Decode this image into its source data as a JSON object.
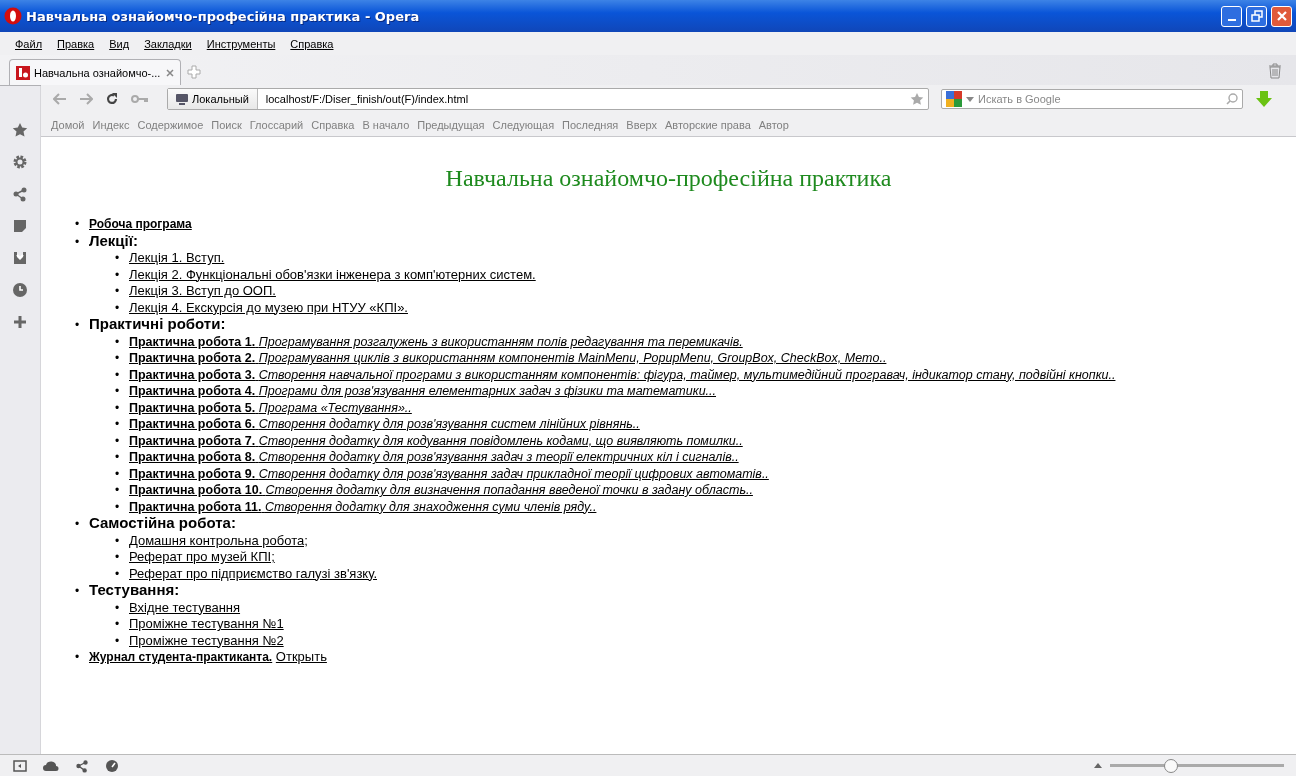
{
  "window": {
    "title": "Навчальна ознайомчо-професійна практика - Opera"
  },
  "menu": [
    "Файл",
    "Правка",
    "Вид",
    "Закладки",
    "Инструменты",
    "Справка"
  ],
  "tabs": [
    {
      "label": "Навчальна ознайомчо-...",
      "selected": true
    }
  ],
  "address_bar": {
    "badge": "Локальный",
    "value": "localhost/F:/Diser_finish/out(F)/index.html"
  },
  "search": {
    "placeholder": "Искать в Google"
  },
  "nav_links": [
    "Домой",
    "Индекс",
    "Содержимое",
    "Поиск",
    "Глоссарий",
    "Справка",
    "В начало",
    "Предыдущая",
    "Следующая",
    "Последняя",
    "Вверх",
    "Авторские права",
    "Автор"
  ],
  "page": {
    "heading": "Навчальна ознайомчо-професійна практика",
    "items": [
      {
        "kind": "link",
        "bullet": "•",
        "text": "Робоча програма"
      },
      {
        "kind": "section",
        "bullet": "•",
        "text": "Лекції:",
        "children": [
          {
            "kind": "plain",
            "bullet": "•",
            "text": "Лекція 1. Вступ."
          },
          {
            "kind": "plain",
            "bullet": "•",
            "text": "Лекція 2. Функціональні обов'язки інженера з комп'ютерних систем."
          },
          {
            "kind": "plain",
            "bullet": "•",
            "text": "Лекція 3. Вступ до ООП."
          },
          {
            "kind": "plain",
            "bullet": "•",
            "text": "Лекція 4. Екскурсія до музею при НТУУ «КПІ»."
          }
        ]
      },
      {
        "kind": "section",
        "bullet": "•",
        "text": "Практичні роботи:",
        "children": [
          {
            "kind": "work",
            "bullet": "•",
            "text": "**Практична робота 1.** *Програмування розгалужень з використанням полів редагування та перемикачів.*"
          },
          {
            "kind": "work",
            "bullet": "•",
            "text": "**Практична робота 2.** *Програмування циклів з використанням компонентів MainMenu, PopupMenu, GroupBox, CheckBox, Memo..*"
          },
          {
            "kind": "work",
            "bullet": "•",
            "text": "**Практична робота 3.** *Створення навчальної програми з використанням компонентів: фігура, таймер, мультимедійний програвач, індикатор стану, подвійні кнопки..*"
          },
          {
            "kind": "work",
            "bullet": "•",
            "text": "**Практична робота 4.** *Програми для розв'язування елементарних задач з фізики та математики...*"
          },
          {
            "kind": "work",
            "bullet": "•",
            "text": "**Практична робота 5.** *Програма «Тестування»..*"
          },
          {
            "kind": "work",
            "bullet": "•",
            "text": "**Практична робота 6.** *Створення додатку для розв'язування систем лінійних рівнянь..*"
          },
          {
            "kind": "work",
            "bullet": "•",
            "text": "**Практична робота 7.** *Створення додатку для кодування повідомлень кодами, що виявляють помилки..*"
          },
          {
            "kind": "work",
            "bullet": "•",
            "text": "**Практична робота 8.** *Створення додатку для розв'язування задач з теорії електричних кіл і сигналів..*"
          },
          {
            "kind": "work",
            "bullet": "•",
            "text": "**Практична робота 9.** *Створення додатку для розв'язування задач прикладної теорії цифрових автоматів..*"
          },
          {
            "kind": "work",
            "bullet": "•",
            "text": "**Практична робота 10.** *Створення додатку для визначення попадання введеної точки в задану область..*"
          },
          {
            "kind": "work",
            "bullet": "•",
            "text": "**Практична робота 11.** *Створення додатку для знаходження суми членів ряду..*"
          }
        ]
      },
      {
        "kind": "section",
        "bullet": "•",
        "text": "Самостійна робота:",
        "children": [
          {
            "kind": "plain",
            "bullet": "•",
            "text": "Домашня контрольна робота;"
          },
          {
            "kind": "plain",
            "bullet": "•",
            "text": "Реферат про музей КПІ;"
          },
          {
            "kind": "plain",
            "bullet": "•",
            "text": "Реферат про підприємство галузі зв'язку."
          }
        ]
      },
      {
        "kind": "section",
        "bullet": "•",
        "text": "Тестування:",
        "children": [
          {
            "kind": "plain",
            "bullet": "•",
            "text": "Вхідне тестування"
          },
          {
            "kind": "plain",
            "bullet": "•",
            "text": "Проміжне тестування №1"
          },
          {
            "kind": "plain",
            "bullet": "•",
            "text": "Проміжне тестування №2"
          }
        ]
      },
      {
        "kind": "journal",
        "bullet": "•",
        "text": "Журнал студента-практиканта.",
        "link": "Открыть"
      }
    ]
  },
  "status_bar": {
    "zoom": {
      "level": 0.34
    }
  }
}
